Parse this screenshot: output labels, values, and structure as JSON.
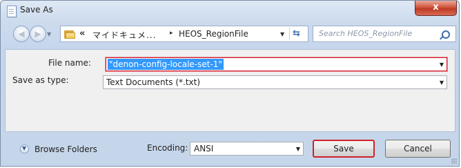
{
  "window": {
    "title": "Save As",
    "close_glyph": "x"
  },
  "nav": {
    "back_icon": "back-arrow-icon",
    "forward_icon": "forward-arrow-icon"
  },
  "address": {
    "overflow": "«",
    "segment_1": "マイドキュメ...",
    "separator": "▸",
    "segment_2": "HEOS_RegionFile"
  },
  "search": {
    "placeholder": "Search HEOS_RegionFile"
  },
  "form": {
    "file_name_label": "File name:",
    "file_name_value": "\"denon-config-locale-set-1\"",
    "save_type_label": "Save as type:",
    "save_type_value": "Text Documents (*.txt)"
  },
  "footer": {
    "browse_label": "Browse Folders",
    "encoding_label": "Encoding:",
    "encoding_value": "ANSI",
    "save_label": "Save",
    "cancel_label": "Cancel"
  },
  "colors": {
    "highlight": "#d0202c",
    "selection": "#3399ff"
  }
}
